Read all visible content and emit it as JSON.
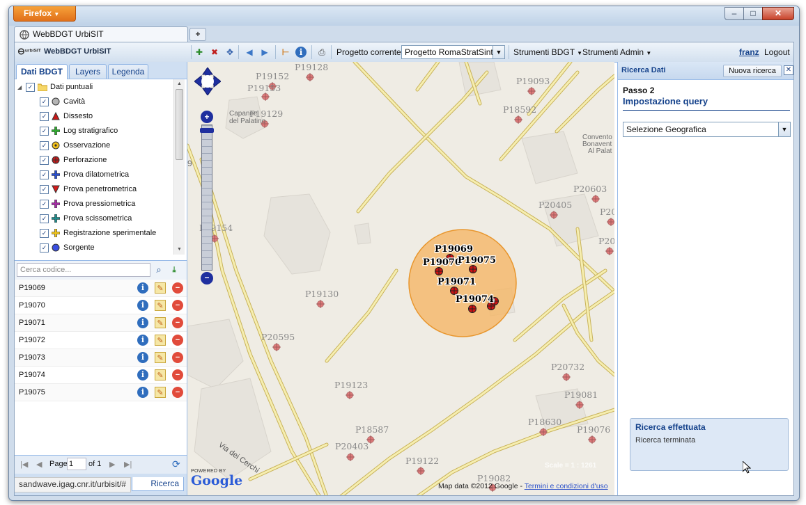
{
  "browser": {
    "app_button": "Firefox",
    "tab_title": "WebBDGT UrbiSIT",
    "new_tab": "+",
    "window_controls": {
      "minimize": "–",
      "maximize": "□",
      "close": "✕"
    },
    "status_url": "sandwave.igag.cnr.it/urbisit/#"
  },
  "toolbar": {
    "logo_text": "urbiSIT",
    "app_title": "WebBDGT UrbiSIT",
    "project_label": "Progetto corrente:",
    "project_value": "Progetto RomaStratSintes",
    "menu_bdgt": "Strumenti BDGT",
    "menu_admin": "Strumenti Admin",
    "user": "franz",
    "logout": "Logout"
  },
  "left_panel": {
    "tabs": [
      "Dati BDGT",
      "Layers",
      "Legenda"
    ],
    "tree_root": "Dati puntuali",
    "layers": [
      {
        "label": "Cavità",
        "icon": "gray-circle"
      },
      {
        "label": "Dissesto",
        "icon": "red-triangle"
      },
      {
        "label": "Log stratigrafico",
        "icon": "green-cross"
      },
      {
        "label": "Osservazione",
        "icon": "yellow-target"
      },
      {
        "label": "Perforazione",
        "icon": "red-crosshair"
      },
      {
        "label": "Prova dilatometrica",
        "icon": "blue-cross"
      },
      {
        "label": "Prova penetrometrica",
        "icon": "red-down-triangle"
      },
      {
        "label": "Prova pressiometrica",
        "icon": "purple-cross"
      },
      {
        "label": "Prova scissometrica",
        "icon": "teal-cross"
      },
      {
        "label": "Registrazione sperimentale",
        "icon": "yellow-cross"
      },
      {
        "label": "Sorgente",
        "icon": "blue-circle"
      }
    ],
    "search_placeholder": "Cerca codice...",
    "results": [
      "P19069",
      "P19070",
      "P19071",
      "P19072",
      "P19073",
      "P19074",
      "P19075"
    ],
    "pager": {
      "page_label": "Page",
      "page_value": "1",
      "of_label": "of 1"
    },
    "bottom_tab": "Ricerca"
  },
  "map": {
    "selected_labels": [
      "P19069",
      "P19070",
      "P19075",
      "P19071",
      "P19074"
    ],
    "other_labels": [
      "P19128",
      "P19152",
      "P19153",
      "P19129",
      "P19093",
      "P18592",
      "P20603",
      "P20405",
      "P20",
      "P19154",
      "P20",
      "P19130",
      "P20595",
      "P19123",
      "P20732",
      "P19081",
      "P18587",
      "P20403",
      "P18630",
      "P19076",
      "P19122",
      "P19082"
    ],
    "place_labels": [
      "Capanne",
      "del Palatino",
      "Convento",
      "Bonavent",
      "Al Palat",
      "9"
    ],
    "street_label": "Via dei Cerchi",
    "powered_by": "POWERED BY",
    "google": "Google",
    "attribution": "Map data ©2012 Google -",
    "terms": "Termini e condizioni d'uso",
    "scale": "Scale = 1 : 1261"
  },
  "right_panel": {
    "title": "Ricerca Dati",
    "new_search": "Nuova ricerca",
    "step": "Passo 2",
    "step_title": "Impostazione query",
    "select_value": "Selezione Geografica",
    "toast_title": "Ricerca effettuata",
    "toast_text": "Ricerca terminata"
  },
  "colors": {
    "accent": "#15428b",
    "selection_fill": "#f5b766",
    "road": "#f2e7a2",
    "marker": "#c81818"
  }
}
